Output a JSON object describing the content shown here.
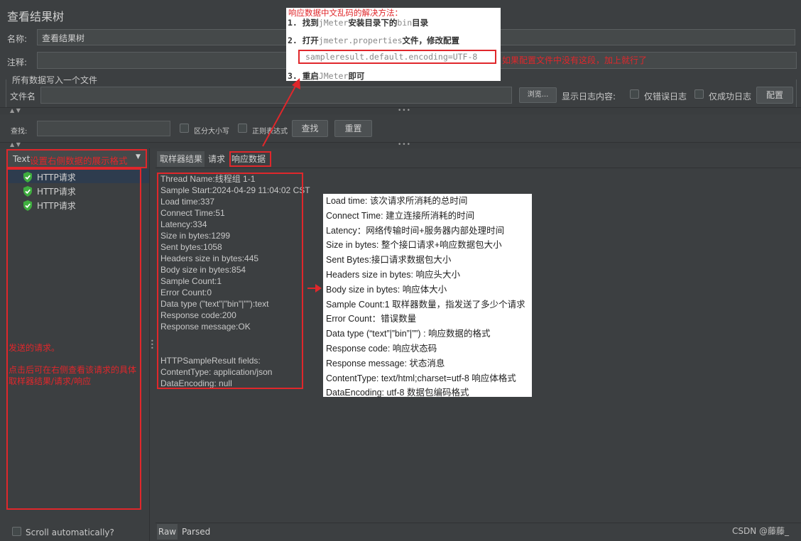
{
  "window": {
    "title": "查看结果树"
  },
  "form": {
    "name_label": "名称:",
    "name_value": "查看结果树",
    "comment_label": "注释:",
    "section_label": "所有数据写入一个文件",
    "filename_label": "文件名",
    "browse_button": "浏览...",
    "log_label": "显示日志内容:",
    "errors_only": "仅错误日志",
    "success_only": "仅成功日志",
    "configure_button": "配置"
  },
  "search": {
    "label": "查找:",
    "case_sensitive": "区分大小写",
    "regex": "正则表达式",
    "find_button": "查找",
    "reset_button": "重置"
  },
  "renderer": {
    "selected": "Text"
  },
  "tree": {
    "items": [
      "HTTP请求",
      "HTTP请求",
      "HTTP请求"
    ],
    "scroll_auto": "Scroll automatically?"
  },
  "tabs": [
    "取样器结果",
    "请求",
    "响应数据"
  ],
  "bottom_tabs": [
    "Raw",
    "Parsed"
  ],
  "result": {
    "lines": [
      "Thread Name:线程组 1-1",
      "Sample Start:2024-04-29 11:04:02 CST",
      "Load time:337",
      "Connect Time:51",
      "Latency:334",
      "Size in bytes:1299",
      "Sent bytes:1058",
      "Headers size in bytes:445",
      "Body size in bytes:854",
      "Sample Count:1",
      "Error Count:0",
      "Data type (\"text\"|\"bin\"|\"\"):text",
      "Response code:200",
      "Response message:OK",
      "",
      "",
      "HTTPSampleResult fields:",
      "ContentType: application/json",
      "DataEncoding: null"
    ]
  },
  "explain": {
    "lines": [
      "Load time: 该次请求所消耗的总时间",
      "Connect Time: 建立连接所消耗的时间",
      "Latency：网络传输时间+服务器内部处理时间",
      "Size in bytes: 整个接口请求+响应数据包大小",
      "Sent Bytes:接口请求数据包大小",
      "Headers size in bytes: 响应头大小",
      "Body size in bytes: 响应体大小",
      "Sample Count:1 取样器数量，指发送了多少个请求",
      "Error Count：错误数量",
      "Data type (“text”|”bin”|””) : 响应数据的格式",
      "Response code: 响应状态码",
      "Response message: 状态消息",
      "ContentType: text/html;charset=utf-8 响应体格式",
      "DataEncoding: utf-8 数据包编码格式"
    ]
  },
  "annotations": {
    "renderer_note": "设置右侧数据的展示格式",
    "tree_note_1": "发送的请求。",
    "tree_note_2": "点击后可在右侧查看该请求的具体取样器结果/请求/响应",
    "config_title": "响应数据中文乱码的解决方法：",
    "step1_num": "1.",
    "step1_a": "找到",
    "step1_b": "jMeter",
    "step1_c": "安装目录下的",
    "step1_d": "bin",
    "step1_e": "目录",
    "step2_num": "2.",
    "step2_a": "打开",
    "step2_b": "jmeter.properties",
    "step2_c": "文件，修改配置",
    "config_line": "sampleresult.default.encoding=UTF-8",
    "config_side_note": "如果配置文件中没有这段，加上就行了",
    "step3_num": "3.",
    "step3_a": "重启",
    "step3_b": "JMeter",
    "step3_c": "即可"
  },
  "watermark": "CSDN @藤藤_"
}
